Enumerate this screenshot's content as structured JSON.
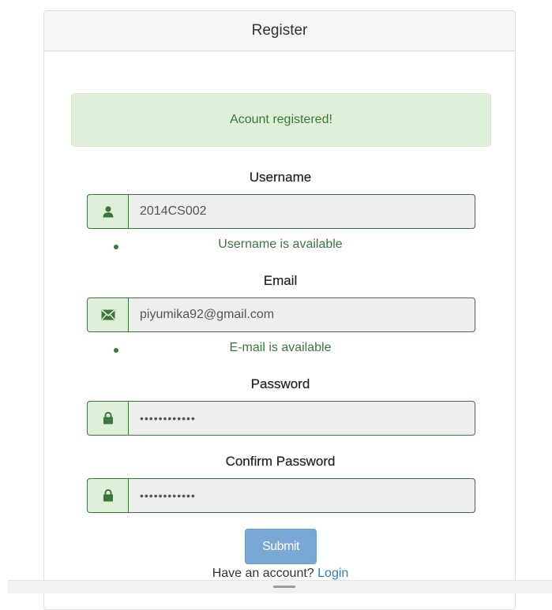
{
  "panel": {
    "title": "Register"
  },
  "alert": {
    "text": "Acount registered!"
  },
  "form": {
    "username": {
      "label": "Username",
      "value": "2014CS002",
      "help": "Username is available",
      "icon": "user-icon"
    },
    "email": {
      "label": "Email",
      "value": "piyumika92@gmail.com",
      "help": "E-mail is available",
      "icon": "envelope-icon"
    },
    "password": {
      "label": "Password",
      "value": "••••••••••••",
      "icon": "lock-icon"
    },
    "confirm_password": {
      "label": "Confirm Password",
      "value": "••••••••••••",
      "icon": "lock-icon"
    },
    "submit_label": "Submit"
  },
  "footer": {
    "prompt": "Have an account?",
    "login_label": "Login"
  },
  "colors": {
    "success_text": "#3c763d",
    "success_bg": "#dff0d8",
    "button_bg": "#7aa8d4",
    "link": "#337ab7"
  }
}
